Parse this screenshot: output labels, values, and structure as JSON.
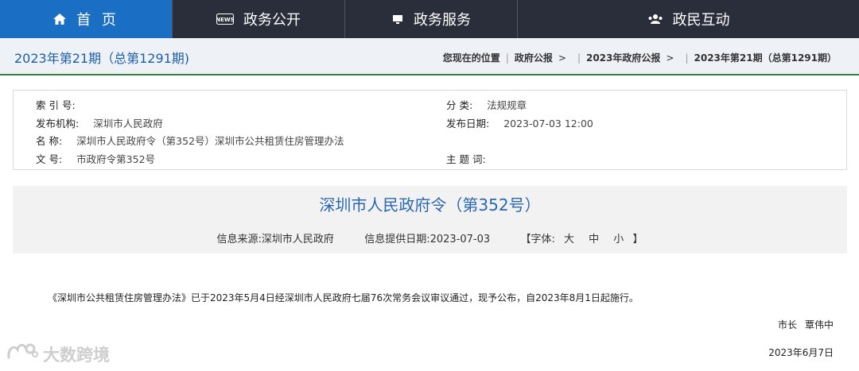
{
  "nav": {
    "items": [
      {
        "label": "首 页",
        "icon": "home-icon",
        "active": true
      },
      {
        "label": "政务公开",
        "icon": "news-icon",
        "active": false
      },
      {
        "label": "政务服务",
        "icon": "monitor-icon",
        "active": false
      },
      {
        "label": "政民互动",
        "icon": "people-icon",
        "active": false
      }
    ]
  },
  "issue": {
    "title": "2023年第21期（总第1291期)"
  },
  "breadcrumb": {
    "label": "您现在的位置",
    "items": [
      "政府公报",
      "2023年政府公报",
      "2023年第21期（总第1291期）"
    ],
    "arrow": ">"
  },
  "info": {
    "index_label": "索 引 号:",
    "index_value": "",
    "category_label": "分 类:",
    "category_value": "法规规章",
    "publisher_label": "发布机构:",
    "publisher_value": "深圳市人民政府",
    "date_label": "发布日期:",
    "date_value": "2023-07-03 12:00",
    "name_label": "名 称:",
    "name_value": "深圳市人民政府令（第352号）深圳市公共租赁住房管理办法",
    "docno_label": "文 号:",
    "docno_value": "市政府令第352号",
    "keywords_label": "主 题 词:",
    "keywords_value": ""
  },
  "document": {
    "title": "深圳市人民政府令（第352号）",
    "source_label": "信息来源:",
    "source_value": "深圳市人民政府",
    "provided_date_label": "信息提供日期:",
    "provided_date_value": "2023-07-03",
    "font_open": "【字体:",
    "font_large": "大",
    "font_medium": "中",
    "font_small": "小",
    "font_close": "】",
    "body": "《深圳市公共租赁住房管理办法》已于2023年5月4日经深圳市人民政府七届76次常务会议审议通过，现予公布，自2023年8月1日起施行。",
    "signer_title": "市长",
    "signer_name": "覃伟中",
    "sign_date": "2023年6月7日"
  },
  "watermark": {
    "text": "大数跨境",
    "icon": "watermark-logo-icon"
  },
  "colors": {
    "nav_bg": "#2a2e3a",
    "nav_active": "#1a6fc5",
    "issue_title": "#1d5fa8",
    "accent_line": "#2e8b3d",
    "doc_title": "#2a68b1"
  }
}
